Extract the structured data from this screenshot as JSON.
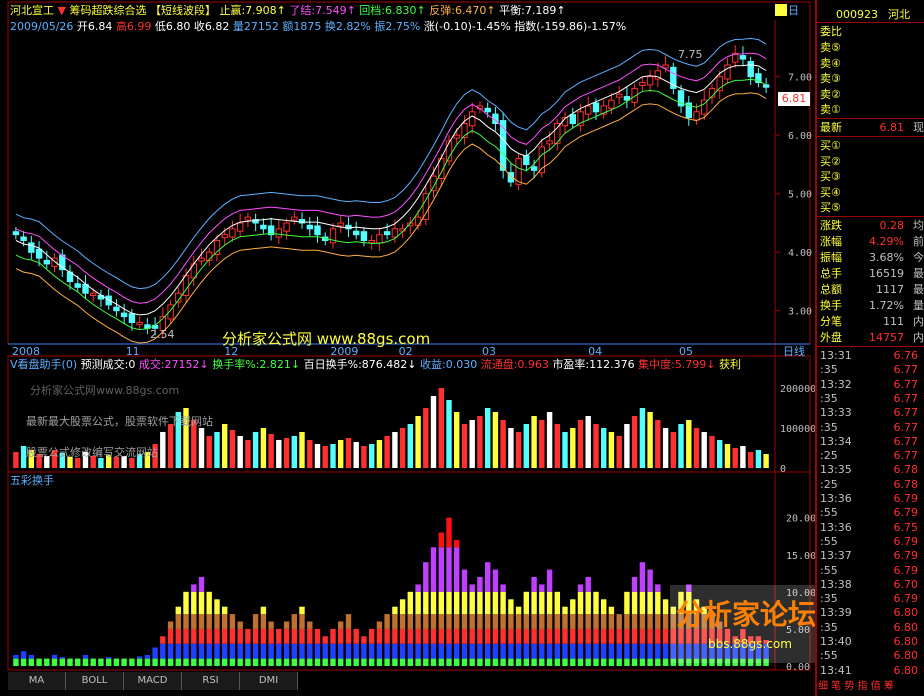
{
  "header": {
    "stock_name": "河北宣工",
    "formula_name": "筹码超跌综合选",
    "strategy_name": "【短线波段】",
    "stop_loss": "止赢:7.908↑",
    "exit": "了结:7.549↑",
    "pullback": "回档:6.830↑",
    "rebound": "反弹:6.470↑",
    "balance": "平衡:7.189↑",
    "date": "2009/05/26",
    "open": "开6.84",
    "high": "高6.99",
    "low": "低6.80",
    "close": "收6.82",
    "volume": "量27152",
    "amount": "额1875",
    "turnover": "换2.82%",
    "amplitude": "振2.75%",
    "change": "涨(-0.10)-1.45%",
    "index": "指数(-159.86)-1.57%"
  },
  "main_chart": {
    "price_labels": [
      "7.00",
      "6.00",
      "5.00",
      "4.00",
      "3.00"
    ],
    "price_values": [
      7,
      6,
      5,
      4,
      3
    ],
    "y_range": [
      2.5,
      7.9
    ],
    "high_marker": "7.75",
    "low_marker": "2.54",
    "current_price": "6.81",
    "date_labels": [
      "2008",
      "11",
      "12",
      "2009",
      "02",
      "03",
      "04",
      "05"
    ],
    "period_button": "日线",
    "top_button": "日"
  },
  "volume_panel": {
    "title": "V看盘助手(0)",
    "forecast": "预测成交:0",
    "deal": "成交:27152↓",
    "turnover_rate": "换手率%:2.821↓",
    "turnover_100": "百日换手%:876.482↓",
    "yield": "收益:0.030",
    "float_shares": "流通盘:0.963",
    "pe": "市盈率:112.376",
    "concentration": "集中度:5.799↓",
    "profit": "获利",
    "axis_labels": [
      "200000",
      "100000",
      "0"
    ],
    "axis_values": [
      200000,
      100000,
      0
    ]
  },
  "turnover_panel": {
    "title": "五彩换手",
    "axis_labels": [
      "20.00",
      "15.00",
      "10.00",
      "5.00",
      "0.00"
    ],
    "axis_values": [
      20,
      15,
      10,
      5,
      0
    ]
  },
  "watermarks": {
    "main_site": "分析家公式网 www.88gs.com",
    "line1": "分析家公式网www.88gs.com",
    "line2": "最新最大股票公式，股票软件下载网站",
    "line3": "股票公式修改编写交流网站",
    "forum": "分析家论坛",
    "forum_url": "bbs.88gs.com"
  },
  "tabs": [
    "MA",
    "BOLL",
    "MACD",
    "RSI",
    "DMI"
  ],
  "sidebar": {
    "code": "000923",
    "name": "河北",
    "ratio_label": "委比",
    "sell": [
      "卖⑤",
      "卖④",
      "卖③",
      "卖②",
      "卖①"
    ],
    "latest_label": "最新",
    "latest_value": "6.81",
    "latest_tag": "现",
    "buy": [
      "买①",
      "买②",
      "买③",
      "买④",
      "买⑤"
    ],
    "stats": [
      {
        "label": "涨跌",
        "value": "0.28",
        "tag": "均"
      },
      {
        "label": "涨幅",
        "value": "4.29%",
        "tag": "前"
      },
      {
        "label": "振幅",
        "value": "3.68%",
        "tag": "今"
      },
      {
        "label": "总手",
        "value": "16519",
        "tag": "最"
      },
      {
        "label": "总额",
        "value": "1117",
        "tag": "最"
      },
      {
        "label": "换手",
        "value": "1.72%",
        "tag": "量"
      },
      {
        "label": "分笔",
        "value": "111",
        "tag": "内"
      }
    ],
    "outer_label": "外盘",
    "outer_value": "14757",
    "outer_tag": "内",
    "trades": [
      {
        "time": "13:31",
        "price": "6.76"
      },
      {
        "time": ":35",
        "price": "6.77"
      },
      {
        "time": "13:32",
        "price": "6.77"
      },
      {
        "time": ":35",
        "price": "6.77"
      },
      {
        "time": "13:33",
        "price": "6.77"
      },
      {
        "time": ":35",
        "price": "6.77"
      },
      {
        "time": "13:34",
        "price": "6.77"
      },
      {
        "time": ":25",
        "price": "6.77"
      },
      {
        "time": "13:35",
        "price": "6.78"
      },
      {
        "time": ":25",
        "price": "6.78"
      },
      {
        "time": "13:36",
        "price": "6.79"
      },
      {
        "time": ":55",
        "price": "6.79"
      },
      {
        "time": "13:36",
        "price": "6.75"
      },
      {
        "time": ":55",
        "price": "6.79"
      },
      {
        "time": "13:37",
        "price": "6.79"
      },
      {
        "time": ":55",
        "price": "6.79"
      },
      {
        "time": "13:38",
        "price": "6.70"
      },
      {
        "time": ":35",
        "price": "6.79"
      },
      {
        "time": "13:39",
        "price": "6.80"
      },
      {
        "time": ":35",
        "price": "6.80"
      },
      {
        "time": "13:40",
        "price": "6.80"
      },
      {
        "time": ":55",
        "price": "6.80"
      },
      {
        "time": "13:41",
        "price": "6.80"
      }
    ],
    "footer": "细 笔 势 指 值 筹"
  },
  "colors": {
    "up": "#ff3030",
    "down": "#54ffff",
    "frame": "#a00000",
    "band1": "#5fb0ff",
    "band2": "#ff50ff",
    "band3": "#ffffff",
    "band4": "#40ff40",
    "band5": "#ffb040",
    "yellow": "#ffff40",
    "green": "#40ff40"
  },
  "chart_data": [
    {
      "type": "candlestick",
      "title": "",
      "x_dates": [
        "2008",
        "11",
        "12",
        "2009",
        "02",
        "03",
        "04",
        "05"
      ],
      "ylim": [
        2.5,
        7.9
      ],
      "closes": [
        4.3,
        4.2,
        4.0,
        3.9,
        3.8,
        3.9,
        3.7,
        3.5,
        3.4,
        3.3,
        3.3,
        3.2,
        3.1,
        3.0,
        2.9,
        2.8,
        2.8,
        2.7,
        2.7,
        2.9,
        3.1,
        3.3,
        3.6,
        3.8,
        3.9,
        4.0,
        4.2,
        4.3,
        4.4,
        4.5,
        4.6,
        4.5,
        4.4,
        4.3,
        4.4,
        4.5,
        4.6,
        4.5,
        4.4,
        4.3,
        4.2,
        4.4,
        4.5,
        4.4,
        4.3,
        4.2,
        4.2,
        4.3,
        4.3,
        4.4,
        4.4,
        4.5,
        4.6,
        5.0,
        5.3,
        5.6,
        5.9,
        6.0,
        6.2,
        6.4,
        6.5,
        6.4,
        6.2,
        5.4,
        5.2,
        5.6,
        5.5,
        5.4,
        5.8,
        5.9,
        6.2,
        6.3,
        6.2,
        6.4,
        6.5,
        6.4,
        6.5,
        6.6,
        6.7,
        6.6,
        6.8,
        6.9,
        7.0,
        7.1,
        7.2,
        6.8,
        6.5,
        6.3,
        6.4,
        6.6,
        6.8,
        7.0,
        7.2,
        7.4,
        7.3,
        7.0,
        6.9,
        6.82
      ]
    },
    {
      "type": "bar",
      "title": "V看盘助手(0)",
      "ylim": [
        0,
        240000
      ],
      "values": [
        40000,
        55000,
        45000,
        35000,
        30000,
        45000,
        38000,
        28000,
        25000,
        40000,
        30000,
        25000,
        32000,
        28000,
        30000,
        25000,
        35000,
        40000,
        60000,
        90000,
        110000,
        140000,
        150000,
        120000,
        100000,
        80000,
        90000,
        110000,
        95000,
        80000,
        70000,
        90000,
        100000,
        85000,
        70000,
        75000,
        80000,
        90000,
        70000,
        60000,
        55000,
        60000,
        70000,
        75000,
        65000,
        55000,
        60000,
        70000,
        80000,
        90000,
        100000,
        110000,
        130000,
        150000,
        180000,
        200000,
        170000,
        140000,
        110000,
        120000,
        130000,
        150000,
        140000,
        120000,
        100000,
        90000,
        110000,
        130000,
        120000,
        140000,
        110000,
        90000,
        100000,
        120000,
        130000,
        110000,
        100000,
        90000,
        80000,
        110000,
        130000,
        150000,
        140000,
        120000,
        100000,
        90000,
        110000,
        120000,
        100000,
        90000,
        80000,
        70000,
        60000,
        50000,
        55000,
        40000,
        45000,
        35000
      ]
    },
    {
      "type": "bar",
      "title": "五彩换手",
      "ylim": [
        0,
        24
      ],
      "values": [
        1.5,
        2,
        1.5,
        1,
        1,
        1.5,
        1.2,
        1,
        1,
        1.5,
        1,
        1,
        1.2,
        1,
        1,
        1,
        1.3,
        1.5,
        2.5,
        4,
        6,
        8,
        10,
        11,
        12,
        10,
        9,
        8,
        7,
        6,
        5,
        7,
        8,
        6,
        5,
        6,
        7,
        8,
        6,
        5,
        4,
        5,
        6,
        7,
        5,
        4,
        5,
        6,
        7,
        8,
        9,
        10,
        11,
        14,
        16,
        18,
        20,
        17,
        13,
        11,
        12,
        14,
        13,
        11,
        9,
        8,
        10,
        12,
        11,
        13,
        10,
        8,
        9,
        11,
        12,
        10,
        9,
        8,
        7,
        10,
        12,
        14,
        13,
        11,
        9,
        8,
        10,
        11,
        9,
        8,
        7,
        6,
        5,
        4,
        5,
        4,
        4,
        3.5
      ]
    }
  ]
}
